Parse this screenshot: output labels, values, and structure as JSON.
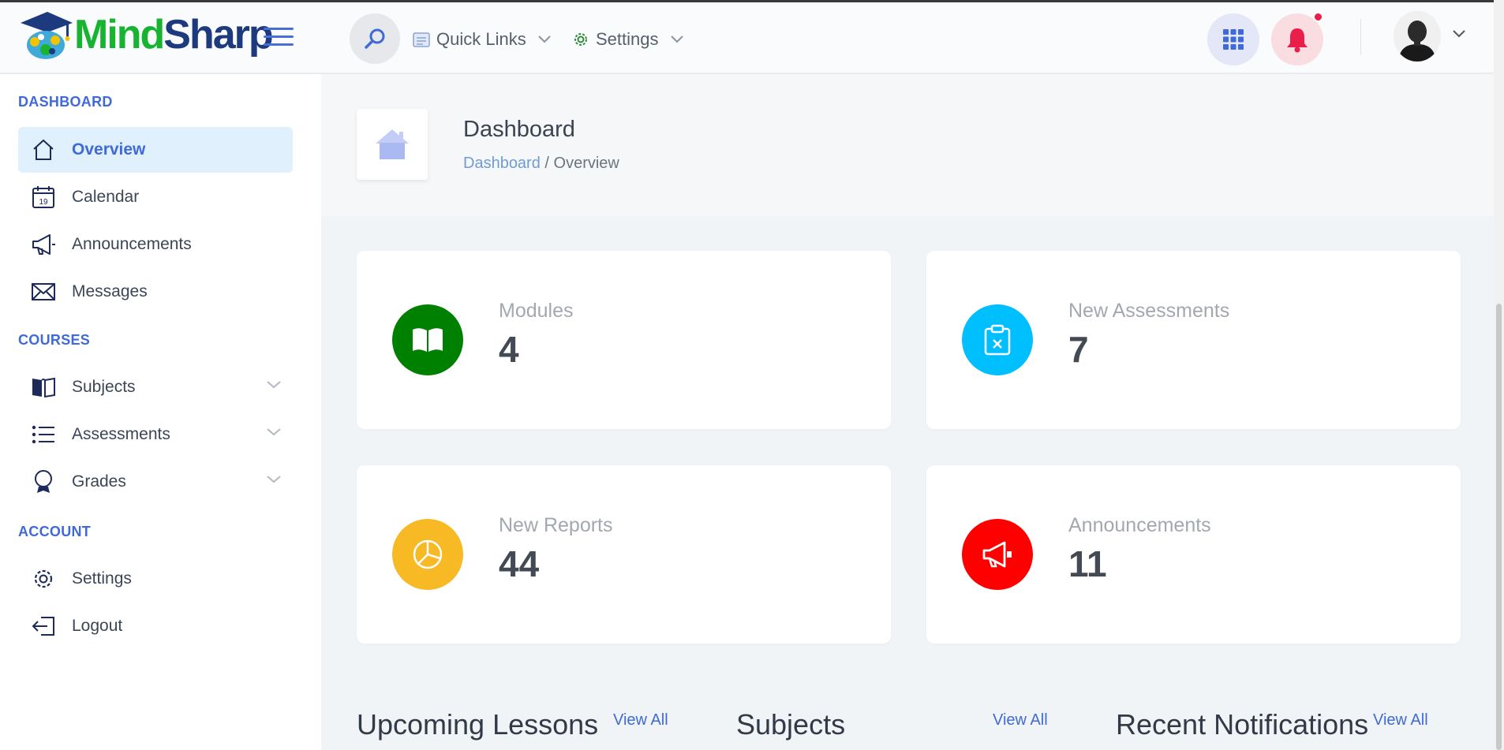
{
  "app": {
    "logo_part1": "Mind",
    "logo_part2": "Sharp"
  },
  "header": {
    "quick_links_label": "Quick Links",
    "settings_label": "Settings"
  },
  "sidebar": {
    "sections": {
      "dashboard": "DASHBOARD",
      "courses": "COURSES",
      "account": "ACCOUNT"
    },
    "items": {
      "overview": "Overview",
      "calendar": "Calendar",
      "calendar_day": "19",
      "announcements": "Announcements",
      "messages": "Messages",
      "subjects": "Subjects",
      "assessments": "Assessments",
      "grades": "Grades",
      "settings": "Settings",
      "logout": "Logout"
    }
  },
  "page_title": {
    "heading": "Dashboard",
    "breadcrumb_link": "Dashboard",
    "breadcrumb_sep": " / ",
    "breadcrumb_current": "Overview"
  },
  "cards": {
    "modules": {
      "label": "Modules",
      "value": "4",
      "color": "#008000"
    },
    "new_assessments": {
      "label": "New Assessments",
      "value": "7",
      "color": "#00bfff"
    },
    "new_reports": {
      "label": "New Reports",
      "value": "44",
      "color": "#f7b924"
    },
    "announcements": {
      "label": "Announcements",
      "value": "11",
      "color": "#ff0000"
    }
  },
  "sections": {
    "upcoming_lessons": "Upcoming Lessons",
    "subjects": "Subjects",
    "recent_notifications": "Recent Notifications",
    "view_all": "View All"
  },
  "colors": {
    "primary": "#3f6ad8",
    "active_bg": "#e0f0fd",
    "notification_dot": "#e91e4a"
  }
}
